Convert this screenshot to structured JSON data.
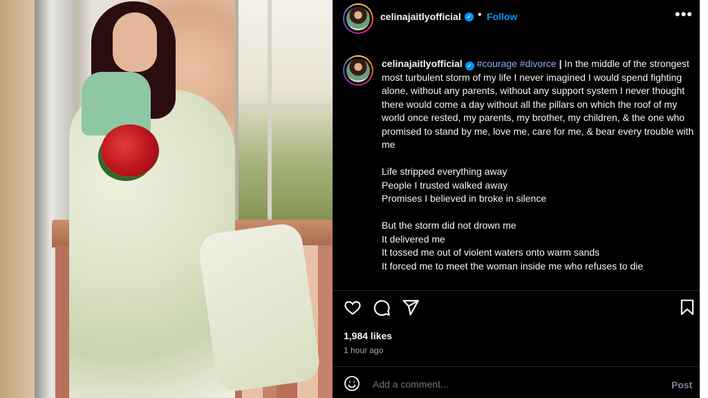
{
  "post": {
    "username": "celinajaitlyofficial",
    "separator": "•",
    "follow_label": "Follow",
    "more_label": "•••"
  },
  "caption": {
    "hashtags": "#courage #divorce",
    "pipe": "|",
    "intro": "In the middle of the strongest most turbulent storm of my life I never imagined I would spend fighting alone, without any parents, without any support system I never thought there would come a day without all the pillars on which the roof of my world once rested, my parents, my brother, my children, & the one who promised to stand by me, love me, care for me, & bear every trouble with me",
    "stanza1": [
      "Life stripped everything away",
      "People I trusted walked away",
      "Promises I believed in broke in silence"
    ],
    "stanza2": [
      "But the storm did not drown me",
      "It delivered me",
      "It tossed me out of violent waters onto warm sands",
      "It forced me to meet the woman inside me who refuses to die"
    ]
  },
  "stats": {
    "likes": "1,984 likes",
    "time": "1 hour ago"
  },
  "comment": {
    "placeholder": "Add a comment...",
    "post_label": "Post"
  },
  "icons": [
    "heart-icon",
    "comment-icon",
    "share-icon",
    "bookmark-icon",
    "emoji-icon",
    "verified-icon",
    "more-icon"
  ],
  "colors": {
    "background": "#000000",
    "text": "#f5f5f5",
    "link_blue": "#0095f6",
    "hashtag": "#8fa8ff",
    "muted": "#a8a8a8"
  }
}
